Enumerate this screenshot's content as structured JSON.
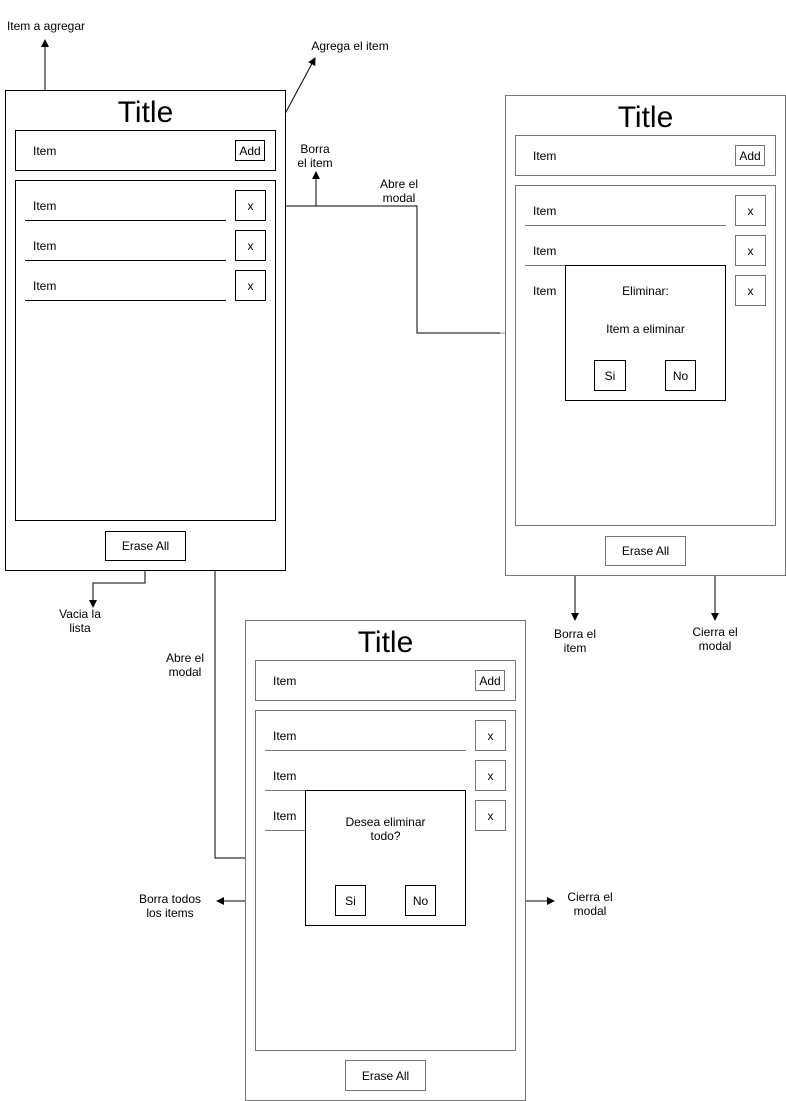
{
  "screens": [
    {
      "title": "Title",
      "input": {
        "placeholder": "Item",
        "add_label": "Add"
      },
      "items": [
        {
          "label": "Item",
          "delete_label": "x"
        },
        {
          "label": "Item",
          "delete_label": "x"
        },
        {
          "label": "Item",
          "delete_label": "x"
        }
      ],
      "erase_all_label": "Erase All"
    },
    {
      "title": "Title",
      "input": {
        "placeholder": "Item",
        "add_label": "Add"
      },
      "items": [
        {
          "label": "Item",
          "delete_label": "x"
        },
        {
          "label": "Item",
          "delete_label": "x"
        },
        {
          "label": "Item",
          "delete_label": "x"
        }
      ],
      "erase_all_label": "Erase All",
      "modal": {
        "heading": "Eliminar:",
        "message": "Item a eliminar",
        "yes_label": "Si",
        "no_label": "No"
      }
    },
    {
      "title": "Title",
      "input": {
        "placeholder": "Item",
        "add_label": "Add"
      },
      "items": [
        {
          "label": "Item",
          "delete_label": "x"
        },
        {
          "label": "Item",
          "delete_label": "x"
        },
        {
          "label": "Item",
          "delete_label": "x"
        }
      ],
      "erase_all_label": "Erase All",
      "modal": {
        "message": "Desea eliminar todo?",
        "yes_label": "Si",
        "no_label": "No"
      }
    }
  ],
  "annotations": {
    "item_to_add": "Item a agregar",
    "adds_item": "Agrega el item",
    "deletes_item_top": "Borra el item",
    "opens_modal_top": "Abre el modal",
    "empties_list": "Vacia la lista",
    "opens_modal_left": "Abre el modal",
    "deletes_item_right": "Borra el item",
    "closes_modal_right": "Cierra el modal",
    "deletes_all_items": "Borra todos los items",
    "closes_modal_bottom": "Cierra el modal"
  }
}
